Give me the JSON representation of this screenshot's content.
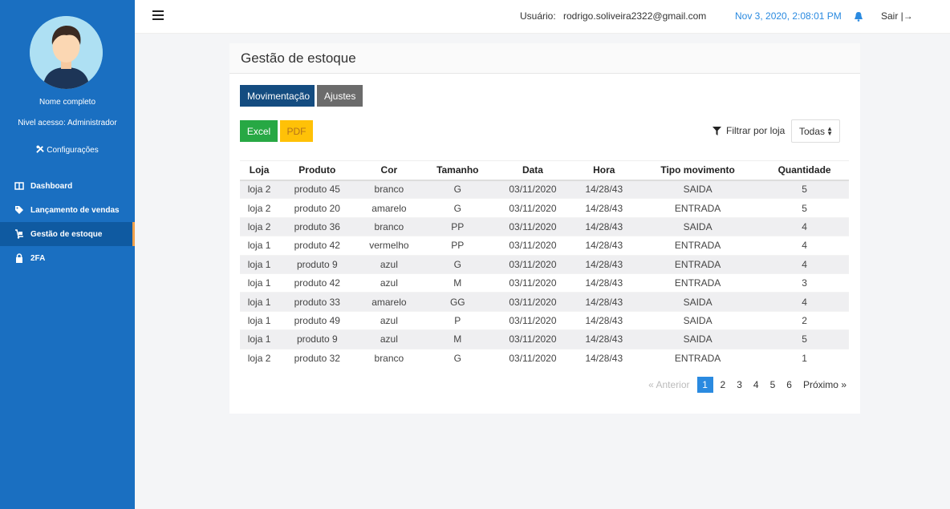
{
  "sidebar": {
    "user_name": "Nome completo",
    "access_level": "Nivel acesso: Administrador",
    "settings_label": "Configurações",
    "items": [
      {
        "label": "Dashboard",
        "icon": "dashboard-icon"
      },
      {
        "label": "Lançamento de vendas",
        "icon": "tag-icon"
      },
      {
        "label": "Gestão de estoque",
        "icon": "dolly-icon",
        "active": true
      },
      {
        "label": "2FA",
        "icon": "lock-icon"
      }
    ]
  },
  "topbar": {
    "user_label": "Usuário:",
    "user_email": "rodrigo.soliveira2322@gmail.com",
    "datetime": "Nov 3, 2020, 2:08:01 PM",
    "logout_label": "Sair |→"
  },
  "card": {
    "title": "Gestão de estoque",
    "tabs": [
      "Movimentação",
      "Ajustes"
    ],
    "excel_label": "Excel",
    "pdf_label": "PDF",
    "filter_label": "Filtrar por loja",
    "filter_value": "Todas"
  },
  "table": {
    "columns": [
      "Loja",
      "Produto",
      "Cor",
      "Tamanho",
      "Data",
      "Hora",
      "Tipo movimento",
      "Quantidade"
    ],
    "rows": [
      [
        "loja 2",
        "produto 45",
        "branco",
        "G",
        "03/11/2020",
        "14/28/43",
        "SAIDA",
        "5"
      ],
      [
        "loja 2",
        "produto 20",
        "amarelo",
        "G",
        "03/11/2020",
        "14/28/43",
        "ENTRADA",
        "5"
      ],
      [
        "loja 2",
        "produto 36",
        "branco",
        "PP",
        "03/11/2020",
        "14/28/43",
        "SAIDA",
        "4"
      ],
      [
        "loja 1",
        "produto 42",
        "vermelho",
        "PP",
        "03/11/2020",
        "14/28/43",
        "ENTRADA",
        "4"
      ],
      [
        "loja 1",
        "produto 9",
        "azul",
        "G",
        "03/11/2020",
        "14/28/43",
        "ENTRADA",
        "4"
      ],
      [
        "loja 1",
        "produto 42",
        "azul",
        "M",
        "03/11/2020",
        "14/28/43",
        "ENTRADA",
        "3"
      ],
      [
        "loja 1",
        "produto 33",
        "amarelo",
        "GG",
        "03/11/2020",
        "14/28/43",
        "SAIDA",
        "4"
      ],
      [
        "loja 1",
        "produto 49",
        "azul",
        "P",
        "03/11/2020",
        "14/28/43",
        "SAIDA",
        "2"
      ],
      [
        "loja 1",
        "produto 9",
        "azul",
        "M",
        "03/11/2020",
        "14/28/43",
        "SAIDA",
        "5"
      ],
      [
        "loja 2",
        "produto 32",
        "branco",
        "G",
        "03/11/2020",
        "14/28/43",
        "ENTRADA",
        "1"
      ]
    ]
  },
  "pagination": {
    "prev_label": "« Anterior",
    "pages": [
      "1",
      "2",
      "3",
      "4",
      "5",
      "6"
    ],
    "current": "1",
    "next_label": "Próximo »"
  },
  "colors": {
    "sidebar_bg": "#1a6fc1",
    "active_tab": "#144c80",
    "excel": "#27a844",
    "pdf": "#ffc107",
    "accent": "#2a8ae0"
  }
}
